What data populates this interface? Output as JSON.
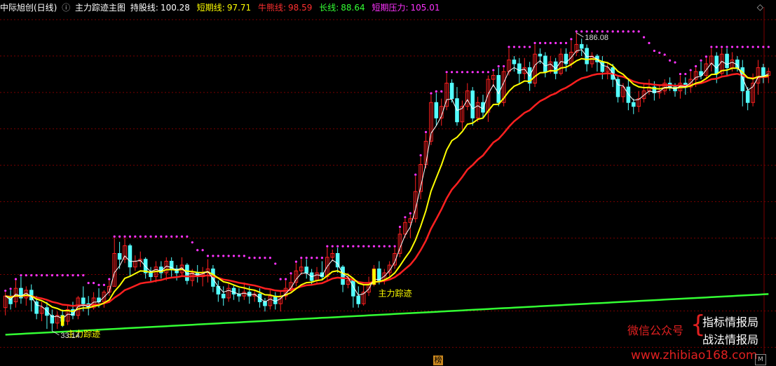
{
  "header": {
    "stock_name": "中际旭创(日线)",
    "collapse_icon": "circle-chevron-icon",
    "indicator_name": "主力踪迹主图",
    "items": [
      {
        "label": "持股线:",
        "value": "100.28",
        "color": "#ffffff"
      },
      {
        "label": "短期线:",
        "value": "97.71",
        "color": "#ffff00"
      },
      {
        "label": "牛熊线:",
        "value": "98.59",
        "color": "#ff3030"
      },
      {
        "label": "长线:",
        "value": "88.64",
        "color": "#33ff33"
      },
      {
        "label": "短期压力:",
        "value": "105.01",
        "color": "#ff33ff"
      }
    ]
  },
  "corner_icons": {
    "top_right": "diamond-icon",
    "bottom_right": "m-icon"
  },
  "bottom_badge": "榜",
  "watermark": {
    "left": "微信公众号",
    "right_top": "指标情报局",
    "right_bottom": "战法情报局",
    "url": "www.zhibiao168.com"
  },
  "colors": {
    "background": "#000000",
    "grid": "#7a0000",
    "up_candle": "#ff2020",
    "down_candle": "#54ffff",
    "hold_line": "#ffffff",
    "short_line": "#ffff00",
    "bull_bear_line": "#ff2020",
    "long_line": "#33ff33",
    "pressure_dots": "#ff33ff",
    "signal_bar": "#ffff00"
  },
  "chart_data": {
    "type": "candlestick",
    "ylim": [
      20,
      195
    ],
    "high_label": "186.08",
    "low_label": "33.14",
    "signal_label": "主力踪迹",
    "signals": [
      {
        "x": 11
      },
      {
        "x": 71
      }
    ],
    "candles": [
      [
        44,
        50,
        40,
        52
      ],
      [
        50,
        46,
        43,
        53
      ],
      [
        47,
        54,
        44,
        58
      ],
      [
        54,
        49,
        46,
        60
      ],
      [
        49,
        53,
        45,
        55
      ],
      [
        53,
        48,
        42,
        56
      ],
      [
        47,
        41,
        38,
        50
      ],
      [
        41,
        44,
        37,
        47
      ],
      [
        44,
        40,
        33,
        47
      ],
      [
        40,
        36,
        32,
        43
      ],
      [
        36,
        40,
        33,
        42
      ],
      [
        40,
        37,
        34,
        43
      ],
      [
        37,
        43,
        35,
        45
      ],
      [
        43,
        40,
        38,
        47
      ],
      [
        40,
        49,
        38,
        50
      ],
      [
        49,
        46,
        42,
        55
      ],
      [
        46,
        44,
        40,
        50
      ],
      [
        44,
        49,
        43,
        52
      ],
      [
        49,
        47,
        44,
        54
      ],
      [
        47,
        52,
        44,
        53
      ],
      [
        52,
        55,
        50,
        58
      ],
      [
        55,
        72,
        55,
        80
      ],
      [
        72,
        69,
        64,
        78
      ],
      [
        69,
        76,
        67,
        80
      ],
      [
        76,
        65,
        60,
        77
      ],
      [
        65,
        68,
        63,
        71
      ],
      [
        68,
        69,
        65,
        73
      ],
      [
        69,
        62,
        59,
        70
      ],
      [
        62,
        60,
        57,
        65
      ],
      [
        60,
        65,
        57,
        68
      ],
      [
        65,
        62,
        59,
        68
      ],
      [
        62,
        68,
        58,
        70
      ],
      [
        68,
        64,
        60,
        70
      ],
      [
        64,
        62,
        58,
        66
      ],
      [
        62,
        66,
        60,
        70
      ],
      [
        66,
        58,
        56,
        67
      ],
      [
        58,
        62,
        55,
        64
      ],
      [
        62,
        60,
        57,
        66
      ],
      [
        60,
        62,
        55,
        65
      ],
      [
        62,
        64,
        57,
        69
      ],
      [
        64,
        55,
        52,
        66
      ],
      [
        55,
        51,
        47,
        58
      ],
      [
        51,
        49,
        45,
        55
      ],
      [
        49,
        54,
        47,
        57
      ],
      [
        54,
        51,
        48,
        56
      ],
      [
        51,
        50,
        47,
        54
      ],
      [
        50,
        52,
        48,
        57
      ],
      [
        52,
        50,
        46,
        55
      ],
      [
        50,
        51,
        47,
        53
      ],
      [
        51,
        47,
        44,
        54
      ],
      [
        47,
        45,
        42,
        49
      ],
      [
        45,
        50,
        43,
        53
      ],
      [
        50,
        46,
        43,
        52
      ],
      [
        46,
        50,
        42,
        53
      ],
      [
        50,
        54,
        48,
        58
      ],
      [
        54,
        57,
        52,
        61
      ],
      [
        57,
        63,
        55,
        67
      ],
      [
        63,
        65,
        61,
        69
      ],
      [
        65,
        62,
        59,
        69
      ],
      [
        62,
        58,
        56,
        64
      ],
      [
        58,
        62,
        56,
        65
      ],
      [
        62,
        60,
        58,
        68
      ],
      [
        60,
        70,
        58,
        75
      ],
      [
        70,
        72,
        68,
        74
      ],
      [
        72,
        65,
        62,
        75
      ],
      [
        65,
        56,
        52,
        66
      ],
      [
        56,
        58,
        54,
        62
      ],
      [
        58,
        50,
        44,
        59
      ],
      [
        50,
        46,
        44,
        55
      ],
      [
        46,
        52,
        45,
        56
      ],
      [
        52,
        56,
        50,
        60
      ],
      [
        56,
        64,
        55,
        66
      ],
      [
        64,
        58,
        56,
        68
      ],
      [
        58,
        62,
        56,
        64
      ],
      [
        62,
        66,
        60,
        68
      ],
      [
        66,
        72,
        64,
        75
      ],
      [
        72,
        82,
        70,
        85
      ],
      [
        82,
        88,
        80,
        90
      ],
      [
        88,
        90,
        80,
        92
      ],
      [
        90,
        104,
        88,
        112
      ],
      [
        104,
        118,
        100,
        122
      ],
      [
        118,
        130,
        116,
        134
      ],
      [
        130,
        150,
        128,
        154
      ],
      [
        150,
        142,
        138,
        155
      ],
      [
        142,
        148,
        138,
        152
      ],
      [
        148,
        160,
        146,
        165
      ],
      [
        160,
        152,
        150,
        162
      ],
      [
        152,
        140,
        138,
        158
      ],
      [
        140,
        148,
        136,
        151
      ],
      [
        148,
        156,
        146,
        160
      ],
      [
        156,
        142,
        138,
        158
      ],
      [
        142,
        150,
        140,
        153
      ],
      [
        150,
        145,
        142,
        154
      ],
      [
        145,
        162,
        140,
        164
      ],
      [
        162,
        164,
        158,
        166
      ],
      [
        164,
        150,
        148,
        168
      ],
      [
        150,
        166,
        148,
        168
      ],
      [
        166,
        172,
        164,
        178
      ],
      [
        172,
        170,
        166,
        174
      ],
      [
        170,
        165,
        160,
        173
      ],
      [
        165,
        168,
        162,
        173
      ],
      [
        168,
        160,
        156,
        171
      ],
      [
        160,
        175,
        158,
        180
      ],
      [
        175,
        174,
        170,
        178
      ],
      [
        174,
        166,
        163,
        176
      ],
      [
        166,
        171,
        165,
        174
      ],
      [
        171,
        165,
        162,
        173
      ],
      [
        165,
        175,
        164,
        178
      ],
      [
        175,
        170,
        166,
        178
      ],
      [
        170,
        176,
        168,
        182
      ],
      [
        176,
        180,
        174,
        186
      ],
      [
        180,
        178,
        174,
        183
      ],
      [
        178,
        170,
        166,
        180
      ],
      [
        170,
        174,
        168,
        176
      ],
      [
        174,
        171,
        166,
        175
      ],
      [
        171,
        166,
        162,
        174
      ],
      [
        166,
        168,
        162,
        171
      ],
      [
        168,
        162,
        158,
        170
      ],
      [
        162,
        153,
        150,
        164
      ],
      [
        153,
        158,
        150,
        160
      ],
      [
        158,
        150,
        146,
        162
      ],
      [
        150,
        148,
        144,
        152
      ],
      [
        148,
        152,
        145,
        156
      ],
      [
        152,
        156,
        150,
        160
      ],
      [
        156,
        158,
        154,
        162
      ],
      [
        158,
        155,
        151,
        161
      ],
      [
        155,
        156,
        152,
        159
      ],
      [
        156,
        160,
        154,
        162
      ],
      [
        160,
        158,
        156,
        163
      ],
      [
        158,
        156,
        153,
        160
      ],
      [
        156,
        160,
        152,
        164
      ],
      [
        160,
        158,
        154,
        163
      ],
      [
        158,
        162,
        155,
        166
      ],
      [
        162,
        166,
        158,
        168
      ],
      [
        166,
        164,
        162,
        171
      ],
      [
        164,
        170,
        162,
        173
      ],
      [
        170,
        174,
        166,
        178
      ],
      [
        174,
        165,
        160,
        176
      ],
      [
        165,
        175,
        164,
        178
      ],
      [
        175,
        168,
        164,
        178
      ],
      [
        168,
        172,
        166,
        176
      ],
      [
        172,
        168,
        166,
        174
      ],
      [
        168,
        156,
        148,
        172
      ],
      [
        156,
        150,
        146,
        158
      ],
      [
        150,
        160,
        148,
        165
      ],
      [
        160,
        168,
        154,
        172
      ],
      [
        168,
        164,
        160,
        170
      ],
      [
        164,
        166,
        160,
        168
      ]
    ],
    "long_line": [
      30,
      51
    ]
  }
}
